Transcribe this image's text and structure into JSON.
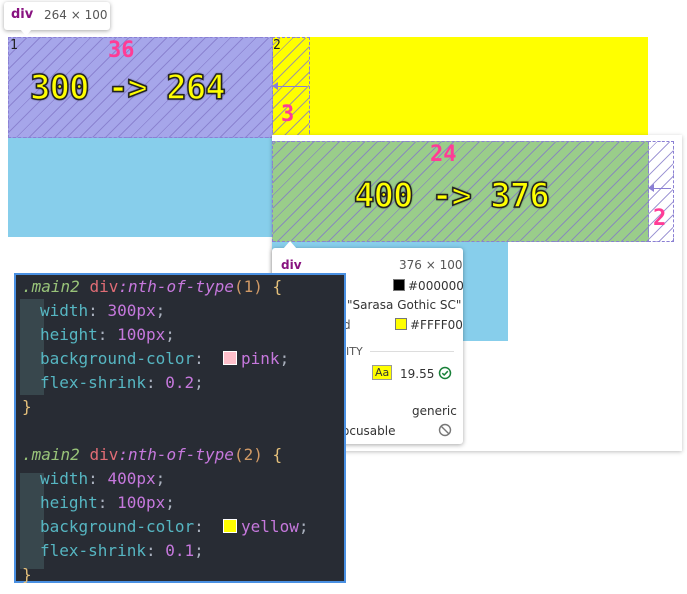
{
  "tooltip": {
    "tag": "div",
    "size": "264 × 100"
  },
  "box1": {
    "label": "300 -> 264",
    "shrink_amount": "36",
    "index": "1"
  },
  "gap1": {
    "index": "2",
    "value": "3"
  },
  "box2": {
    "label": "400 -> 376",
    "shrink_amount": "24"
  },
  "gap2": {
    "value": "2"
  },
  "inspect": {
    "tag": "div",
    "size": "376 × 100",
    "color_value": "#000000",
    "font_value": "\"Sarasa Gothic SC\"",
    "bg_label_partial": "d",
    "bg_value": "#FFFF00",
    "section_partial": "ITY",
    "contrast_badge": "Aa",
    "contrast_value": "19.55",
    "role_value": "generic",
    "focus_partial": "ocusable"
  },
  "code": {
    "rule1": {
      "selector": ".main2",
      "element": "div",
      "pseudo": ":nth-of-type",
      "arg": "1",
      "width_prop": "width",
      "width_num": "300",
      "width_unit": "px",
      "height_prop": "height",
      "height_num": "100",
      "height_unit": "px",
      "bg_prop": "background-color",
      "bg_value": "pink",
      "shrink_prop": "flex-shrink",
      "shrink_value": "0.2"
    },
    "rule2": {
      "selector": ".main2",
      "element": "div",
      "pseudo": ":nth-of-type",
      "arg": "2",
      "width_prop": "width",
      "width_num": "400",
      "width_unit": "px",
      "height_prop": "height",
      "height_num": "100",
      "height_unit": "px",
      "bg_prop": "background-color",
      "bg_value": "yellow",
      "shrink_prop": "flex-shrink",
      "shrink_value": "0.1"
    }
  },
  "colors": {
    "pink": "#ffc0cb",
    "yellow": "#ffff00",
    "skyblue": "#87ceeb"
  }
}
